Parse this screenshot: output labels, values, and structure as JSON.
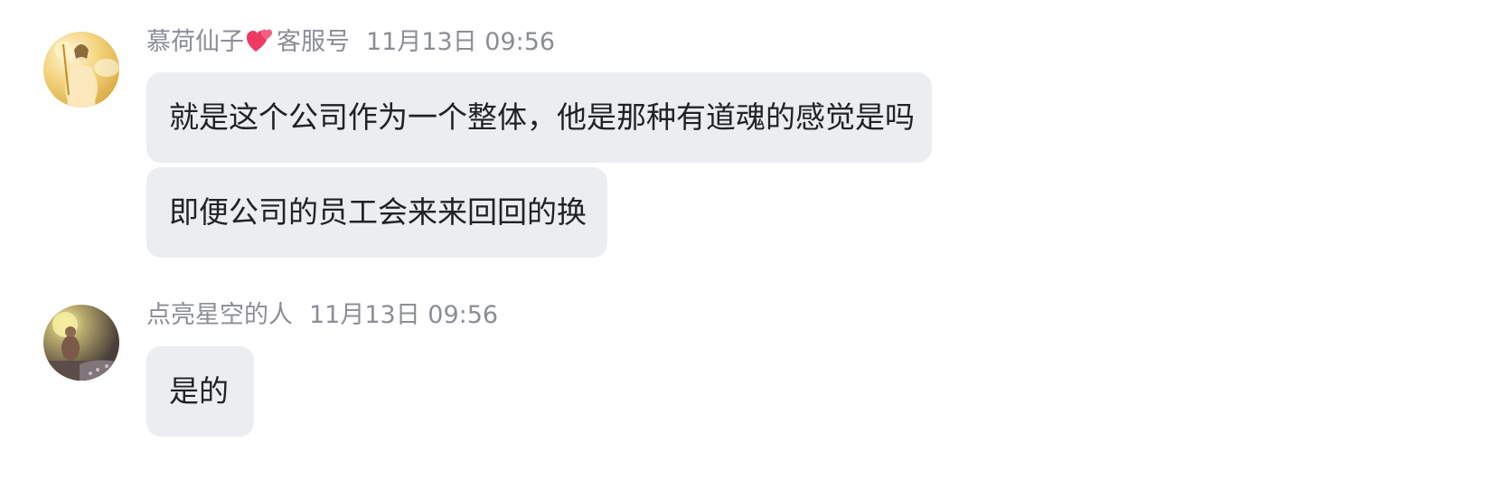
{
  "messages": [
    {
      "sender": {
        "name_before_emoji": "慕荷仙子",
        "emoji": "two-hearts-icon",
        "name_after_emoji": "客服号",
        "time": "11月13日 09:56"
      },
      "bubbles": [
        "就是这个公司作为一个整体，他是那种有道魂的感觉是吗",
        "即便公司的员工会来来回回的换"
      ]
    },
    {
      "sender": {
        "name": "点亮星空的人",
        "time": "11月13日 09:56"
      },
      "bubbles": [
        "是的"
      ]
    }
  ],
  "colors": {
    "bubble_bg": "#ebedf0",
    "meta_text": "#8b8e96",
    "message_text": "#202226",
    "heart": "#ee3a63"
  }
}
